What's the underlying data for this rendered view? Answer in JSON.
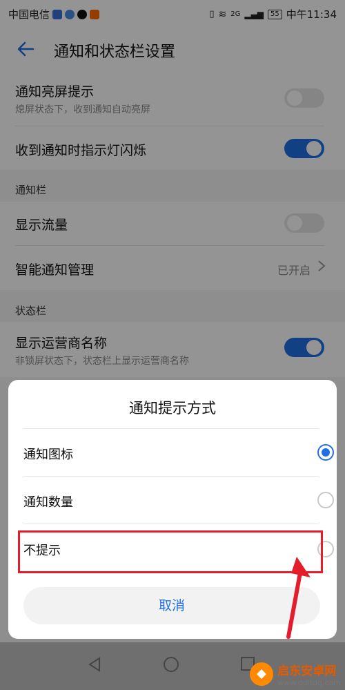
{
  "status_bar": {
    "carrier": "中国电信",
    "battery": "55",
    "time": "中午11:34",
    "network": "2G"
  },
  "app_bar": {
    "back_icon": "arrow-left-icon",
    "title": "通知和状态栏设置"
  },
  "settings": [
    {
      "title": "通知亮屏提示",
      "subtitle": "熄屏状态下，收到通知自动亮屏",
      "toggle": "off"
    },
    {
      "title": "收到通知时指示灯闪烁",
      "toggle": "on"
    }
  ],
  "section_notification": {
    "header": "通知栏",
    "items": [
      {
        "title": "显示流量",
        "toggle": "off"
      },
      {
        "title": "智能通知管理",
        "value": "已开启"
      }
    ]
  },
  "section_statusbar": {
    "header": "状态栏",
    "items": [
      {
        "title": "显示运营商名称",
        "subtitle": "非锁屏状态下，状态栏上显示运营商名称",
        "toggle": "on"
      }
    ]
  },
  "dialog": {
    "title": "通知提示方式",
    "options": [
      {
        "label": "通知图标",
        "selected": true
      },
      {
        "label": "通知数量",
        "selected": false
      },
      {
        "label": "不提示",
        "selected": false
      }
    ],
    "cancel": "取消"
  },
  "watermark": {
    "name": "启东安卓网",
    "url": "www.qdltdq.com"
  },
  "colors": {
    "accent": "#1f6fe5",
    "annotation": "#e41d2c"
  }
}
